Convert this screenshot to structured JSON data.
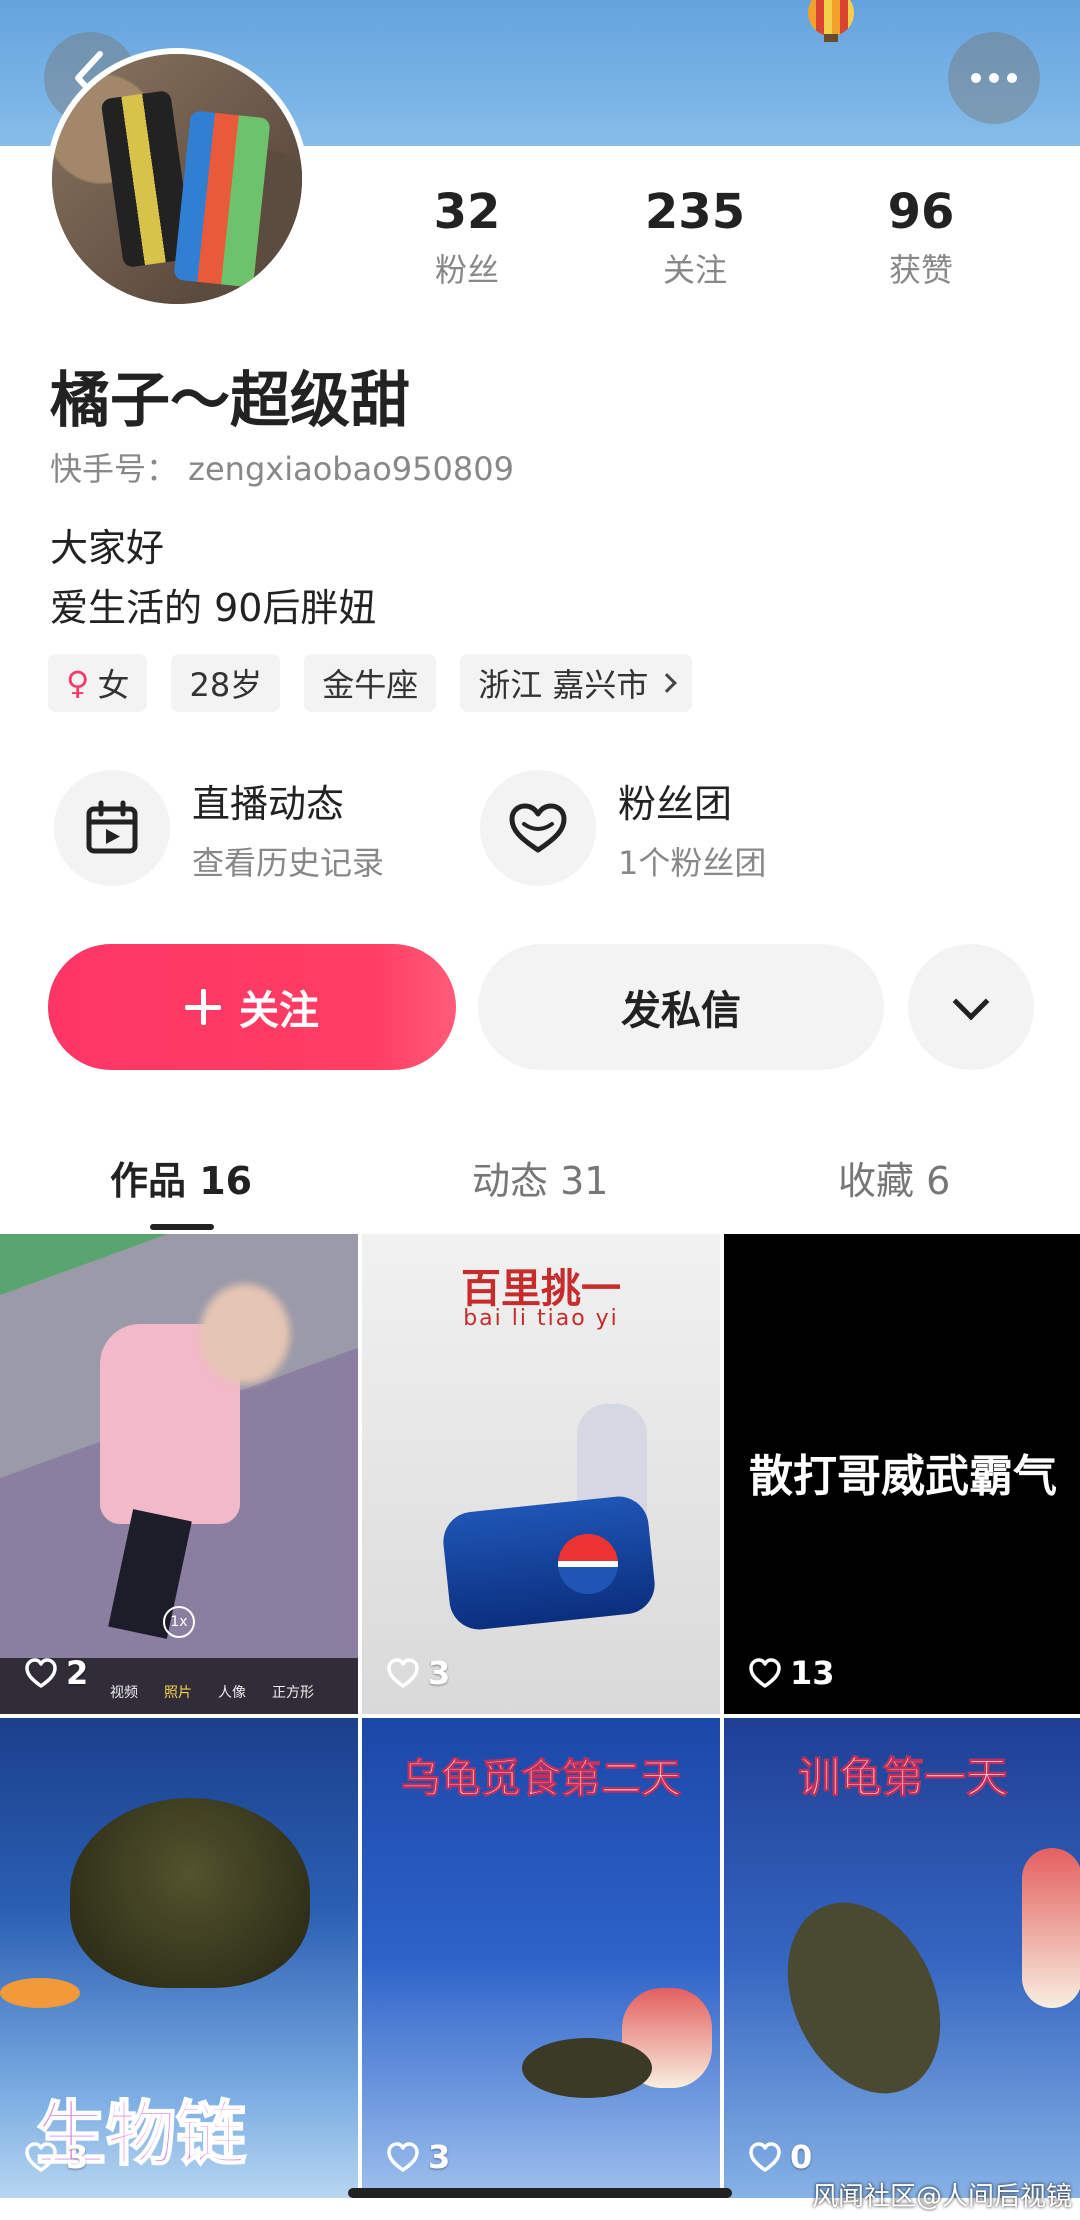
{
  "header": {
    "back_icon": "chevron-left-icon",
    "more_icon": "more-dots-icon"
  },
  "profile": {
    "avatar_alt": "avatar",
    "stats": [
      {
        "value": "32",
        "label": "粉丝"
      },
      {
        "value": "235",
        "label": "关注"
      },
      {
        "value": "96",
        "label": "获赞"
      }
    ],
    "name": "橘子～超级甜",
    "kuaishou_id": "快手号： zengxiaobao950809",
    "bio_line1": "大家好",
    "bio_line2": "爱生活的  90后胖妞",
    "tags": {
      "gender_symbol": "♀",
      "gender": "女",
      "age": "28岁",
      "zodiac": "金牛座",
      "location": "浙江 嘉兴市"
    }
  },
  "features": {
    "live": {
      "title": "直播动态",
      "subtitle": "查看历史记录",
      "icon": "calendar-icon"
    },
    "fan_group": {
      "title": "粉丝团",
      "subtitle": "1个粉丝团",
      "icon": "heart-outline-icon"
    }
  },
  "actions": {
    "follow_label": "关注",
    "message_label": "发私信",
    "accent_color": "#fe3666"
  },
  "tabs": [
    {
      "label": "作品 16",
      "active": true
    },
    {
      "label": "动态 31",
      "active": false
    },
    {
      "label": "收藏 6",
      "active": false
    }
  ],
  "works": [
    {
      "likes": "2",
      "camera_modes": [
        "视频",
        "照片",
        "人像",
        "正方形"
      ],
      "zoom": "1x"
    },
    {
      "likes": "3",
      "title": "百里挑一",
      "subtitle": "bai li tiao yi"
    },
    {
      "likes": "13",
      "text": "散打哥威武霸气"
    },
    {
      "likes": "3",
      "text": "生物链"
    },
    {
      "likes": "3",
      "text": "乌龟觅食第二天"
    },
    {
      "likes": "0",
      "text": "训龟第一天"
    }
  ],
  "watermark": "风闻社区@人间后视镜"
}
